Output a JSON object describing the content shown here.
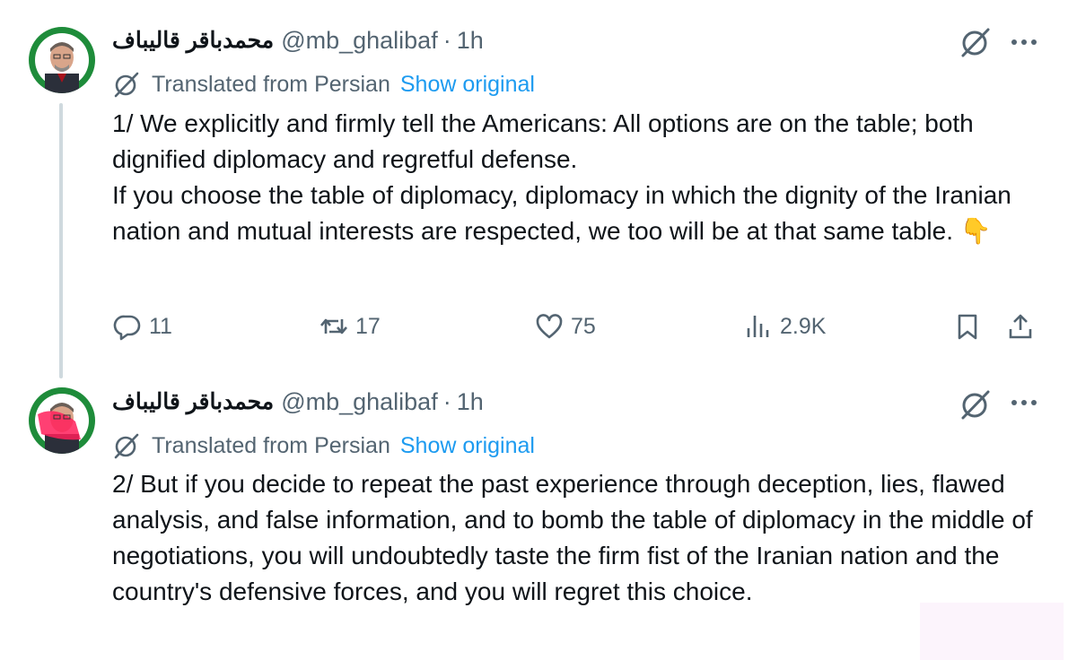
{
  "tweets": [
    {
      "display_name": "محمدباقر قالیباف",
      "handle": "@mb_ghalibaf",
      "separator": "·",
      "time": "1h",
      "translated_label": "Translated from Persian",
      "show_original": "Show original",
      "body": "1/ We explicitly and firmly tell the Americans: All options are on the table; both dignified diplomacy and regretful defense.\nIf you choose the table of diplomacy, diplomacy in which the dignity of the Iranian nation and mutual interests are respected, we too will be at that same table. 👇",
      "stats": {
        "replies": "11",
        "reposts": "17",
        "likes": "75",
        "views": "2.9K"
      }
    },
    {
      "display_name": "محمدباقر قالیباف",
      "handle": "@mb_ghalibaf",
      "separator": "·",
      "time": "1h",
      "translated_label": "Translated from Persian",
      "show_original": "Show original",
      "body": "2/ But if you decide to repeat the past experience through deception, lies, flawed analysis, and false information, and to bomb the table of diplomacy in the middle of negotiations, you will undoubtedly taste the firm fist of the Iranian nation and the country's defensive forces, and you will regret this choice."
    }
  ],
  "icons": {
    "more": "more-icon",
    "grok": "grok-icon",
    "translate": "translate-icon",
    "reply": "reply-icon",
    "repost": "repost-icon",
    "like": "heart-icon",
    "views": "views-icon",
    "bookmark": "bookmark-icon",
    "share": "share-icon"
  },
  "colors": {
    "text": "#0f1419",
    "secondary": "#536471",
    "link": "#1d9bf0",
    "thread_line": "#cfd9de",
    "avatar_green": "#1e8c3a"
  }
}
